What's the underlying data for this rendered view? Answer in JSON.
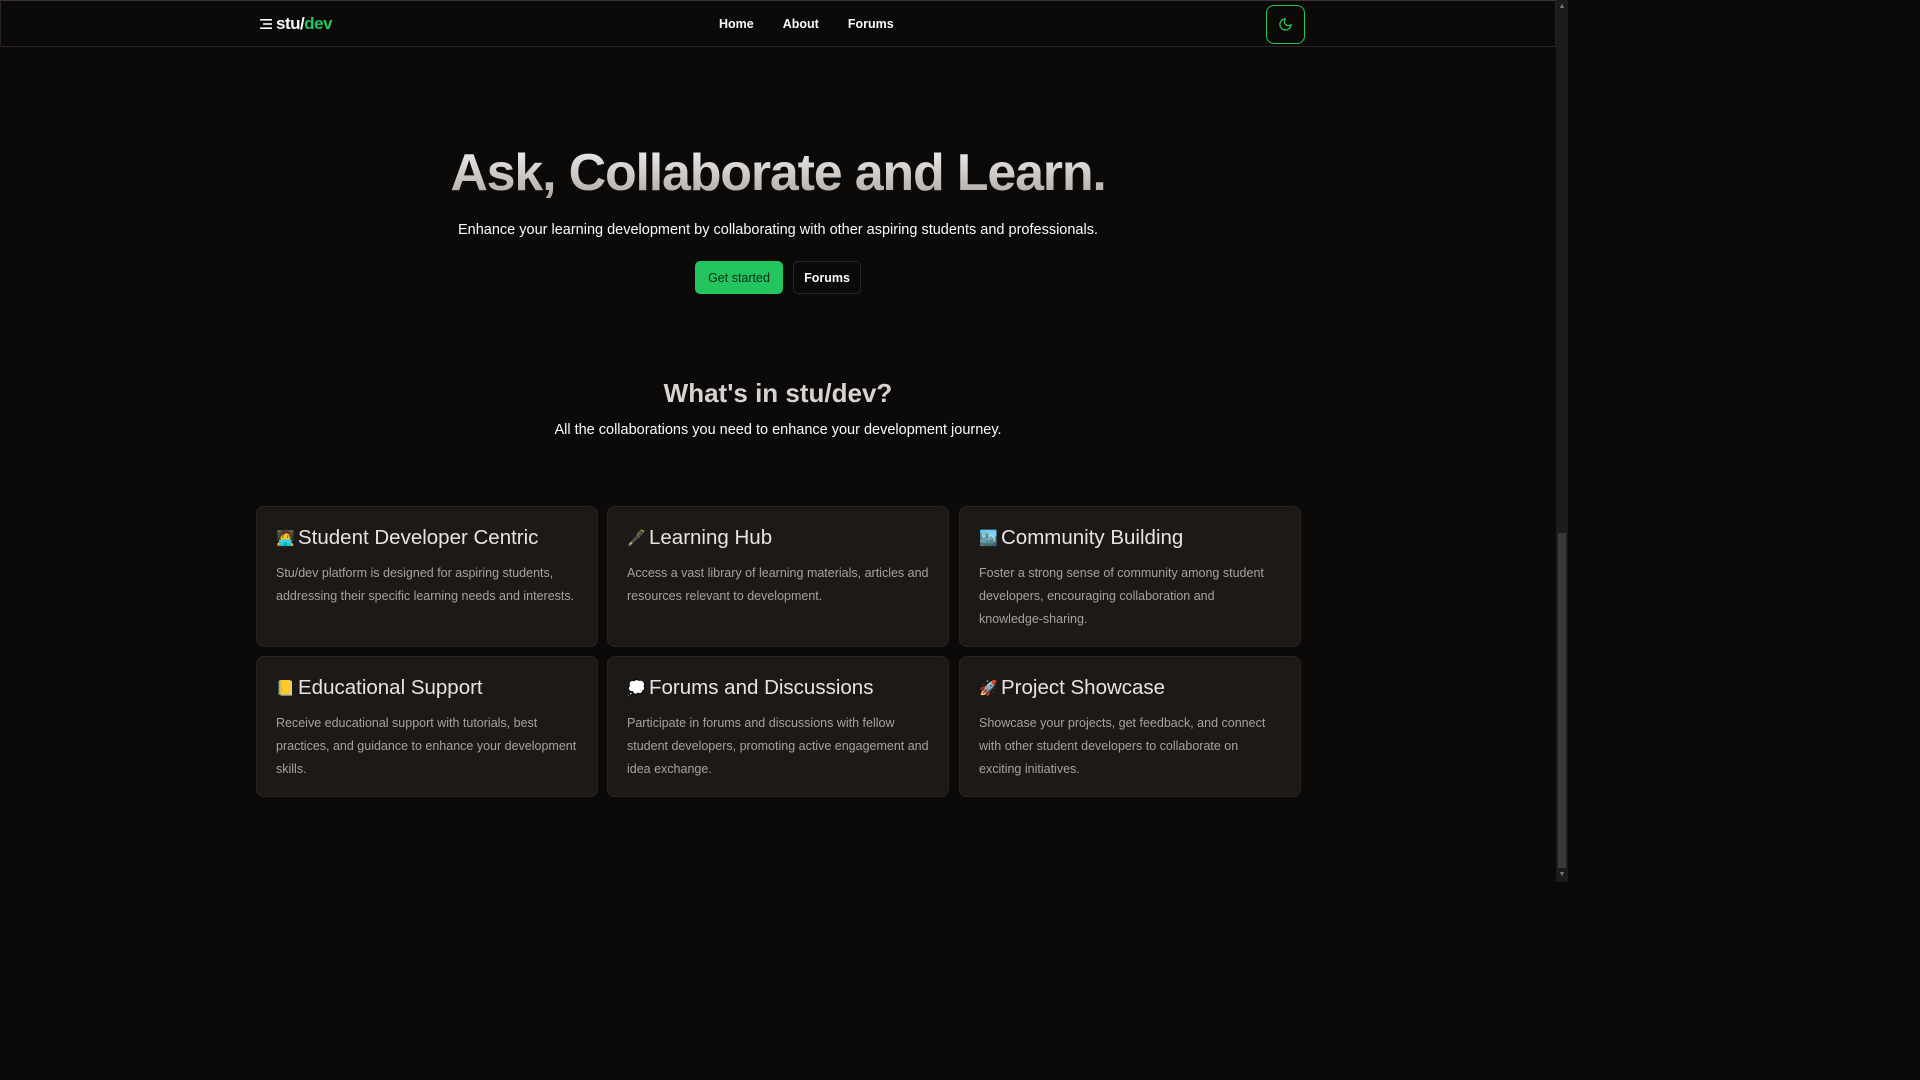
{
  "brand": {
    "prefix": "stu/",
    "suffix": "dev"
  },
  "nav": {
    "links": [
      "Home",
      "About",
      "Forums"
    ]
  },
  "colors": {
    "accent": "#22c55e",
    "background": "#0c0a09",
    "card": "#1c1917"
  },
  "hero": {
    "title": "Ask, Collaborate and Learn.",
    "subtitle": "Enhance your learning development by collaborating with other aspiring students and professionals.",
    "primary_button": "Get started",
    "secondary_button": "Forums"
  },
  "features": {
    "title": "What's in stu/dev?",
    "subtitle": "All the collaborations you need to enhance your development journey.",
    "cards": [
      {
        "emoji": "🧑‍💻",
        "title": "Student Developer Centric",
        "description": "Stu/dev platform is designed for aspiring students, addressing their specific learning needs and interests."
      },
      {
        "emoji": "🖋️",
        "title": "Learning Hub",
        "description": "Access a vast library of learning materials, articles and resources relevant to development."
      },
      {
        "emoji": "🏙️",
        "title": "Community Building",
        "description": "Foster a strong sense of community among student developers, encouraging collaboration and knowledge-sharing."
      },
      {
        "emoji": "📒",
        "title": "Educational Support",
        "description": "Receive educational support with tutorials, best practices, and guidance to enhance your development skills."
      },
      {
        "emoji": "💭",
        "title": "Forums and Discussions",
        "description": "Participate in forums and discussions with fellow student developers, promoting active engagement and idea exchange."
      },
      {
        "emoji": "🚀",
        "title": "Project Showcase",
        "description": "Showcase your projects, get feedback, and connect with other student developers to collaborate on exciting initiatives."
      }
    ]
  },
  "icons": {
    "menu": "menu-icon",
    "theme_toggle": "moon-icon"
  }
}
